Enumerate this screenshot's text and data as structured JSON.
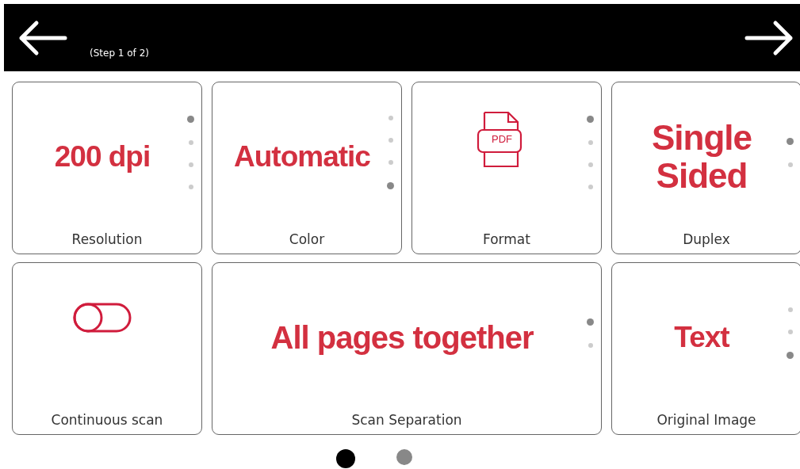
{
  "header": {
    "step": "(Step 1 of 2)"
  },
  "cards": [
    {
      "label": "Resolution",
      "kind": "text",
      "value": "200 dpi",
      "options": [
        {
          "selected": true
        },
        {
          "selected": false
        },
        {
          "selected": false
        },
        {
          "selected": false
        }
      ]
    },
    {
      "label": "Color",
      "kind": "text",
      "value": "Automatic",
      "options": [
        {
          "selected": false
        },
        {
          "selected": false
        },
        {
          "selected": false
        },
        {
          "selected": true
        }
      ]
    },
    {
      "label": "Format",
      "kind": "pdf",
      "icon_text": "PDF",
      "options": [
        {
          "selected": true
        },
        {
          "selected": false
        },
        {
          "selected": false
        },
        {
          "selected": false
        }
      ]
    },
    {
      "label": "Duplex",
      "kind": "text",
      "value": "Single Sided",
      "options": [
        {
          "selected": true
        },
        {
          "selected": false
        }
      ]
    },
    {
      "label": "Continuous scan",
      "kind": "toggle",
      "on": false
    },
    {
      "label": "Scan Separation",
      "kind": "text",
      "value": "All pages together",
      "wide": true,
      "options": [
        {
          "selected": true
        },
        {
          "selected": false
        }
      ]
    },
    {
      "label": "Original Image",
      "kind": "text",
      "value": "Text",
      "options": [
        {
          "selected": false
        },
        {
          "selected": false
        },
        {
          "selected": true
        }
      ]
    }
  ],
  "pages": [
    {
      "selected": true
    },
    {
      "selected": false
    }
  ]
}
